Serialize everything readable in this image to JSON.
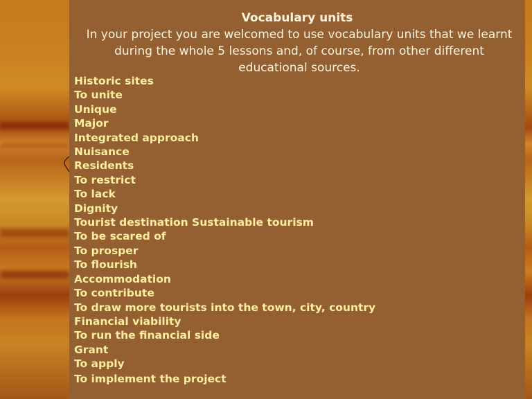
{
  "slide": {
    "title": "Vocabulary units",
    "intro": "In your project you are welcomed to use vocabulary units that we learnt during the whole 5 lessons and, of course, from other different educational sources.",
    "vocabulary": [
      "Historic sites",
      "To unite",
      "Unique",
      "Major",
      "Integrated approach",
      "Nuisance",
      "Residents",
      "To restrict",
      "To lack",
      "Dignity",
      "Tourist destination Sustainable tourism",
      "To be scared of",
      "To prosper",
      "To flourish",
      "Accommodation",
      "To contribute",
      "To draw more tourists into the town, city, country",
      "Financial viability",
      "To run the financial side",
      "Grant",
      "To apply",
      "To implement the project"
    ]
  },
  "colors": {
    "panel": "#956031",
    "title_text": "#fbf3dc",
    "vocab_text": "#fbeea0"
  }
}
